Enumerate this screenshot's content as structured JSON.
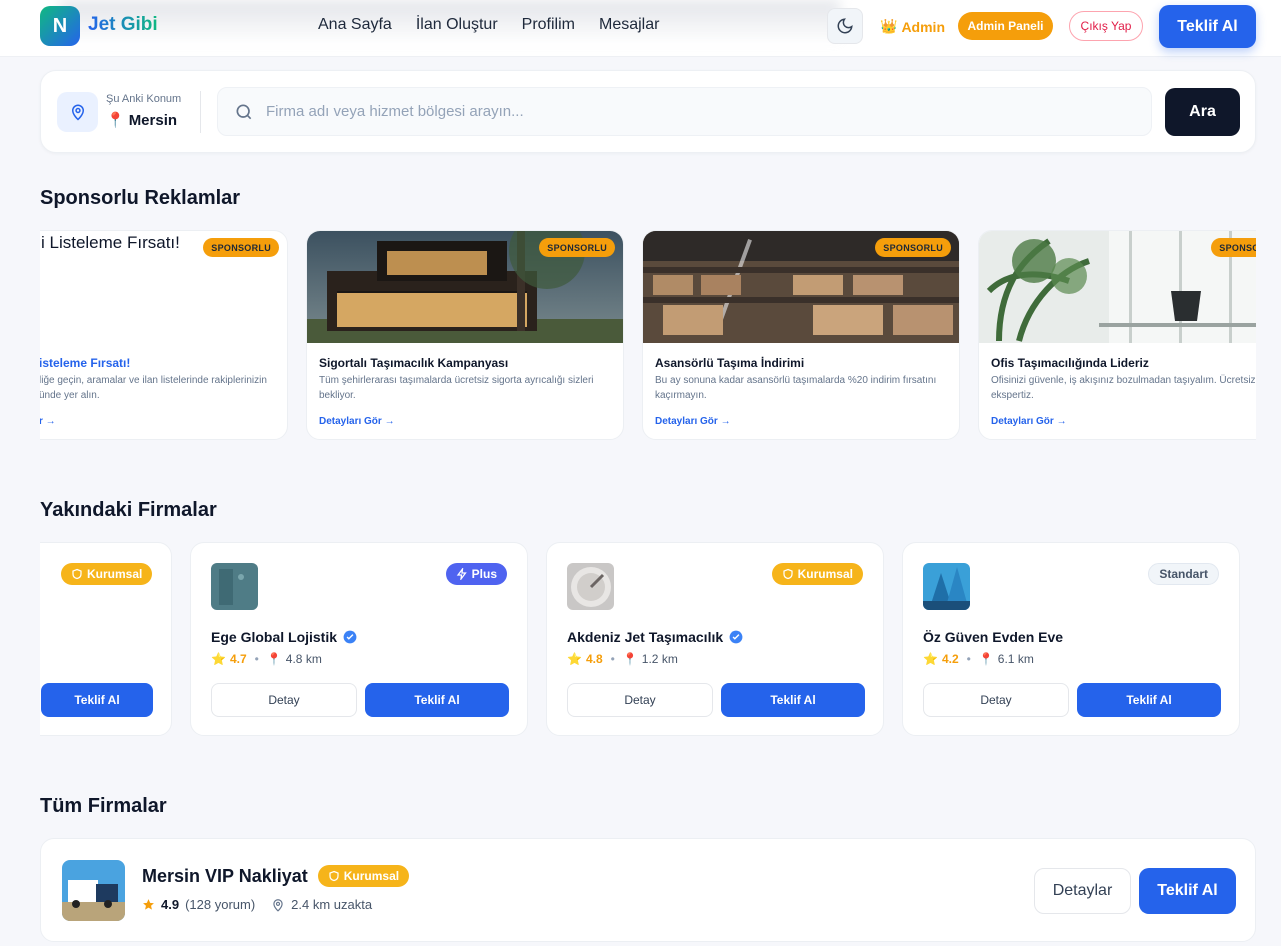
{
  "brand": {
    "logo_letter": "N",
    "name": "Jet Gibi"
  },
  "nav": {
    "links": [
      "Ana Sayfa",
      "İlan Oluştur",
      "Profilim",
      "Mesajlar"
    ],
    "admin_label": "Admin",
    "admin_panel": "Admin Paneli",
    "logout": "Çıkış Yap",
    "quote": "Teklif Al"
  },
  "search": {
    "location_label": "Şu Anki Konum",
    "location_value": "Mersin",
    "placeholder": "Firma adı veya hizmet bölgesi arayın...",
    "button": "Ara"
  },
  "sponsored": {
    "title": "Sponsorlu Reklamlar",
    "badge": "SPONSORLU",
    "link": "Detayları Gör →",
    "ads": [
      {
        "banner": "i Listeleme Fırsatı!",
        "title": "isteleme Fırsatı!",
        "desc": "liğe geçin, aramalar ve ilan listelerinde rakiplerinizin ünde yer alın.",
        "link": "r →"
      },
      {
        "title": "Sigortalı Taşımacılık Kampanyası",
        "desc": "Tüm şehirlerarası taşımalarda ücretsiz sigorta ayrıcalığı sizleri bekliyor."
      },
      {
        "title": "Asansörlü Taşıma İndirimi",
        "desc": "Bu ay sonuna kadar asansörlü taşımalarda %20 indirim fırsatını kaçırmayın."
      },
      {
        "title": "Ofis Taşımacılığında Lideriz",
        "desc": "Ofisinizi güvenle, iş akışınız bozulmadan taşıyalım. Ücretsiz ekspertiz."
      }
    ]
  },
  "nearby": {
    "title": "Yakındaki Firmalar",
    "detail": "Detay",
    "quote": "Teklif Al",
    "firms": [
      {
        "tier": "Kurumsal"
      },
      {
        "name": "Ege Global Lojistik",
        "tier": "Plus",
        "rating": "4.7",
        "distance": "4.8 km"
      },
      {
        "name": "Akdeniz Jet Taşımacılık",
        "tier": "Kurumsal",
        "rating": "4.8",
        "distance": "1.2 km"
      },
      {
        "name": "Öz Güven Evden Eve",
        "tier": "Standart",
        "rating": "4.2",
        "distance": "6.1 km"
      }
    ]
  },
  "all_firms": {
    "title": "Tüm Firmalar",
    "firm": {
      "name": "Mersin VIP Nakliyat",
      "tier": "Kurumsal",
      "rating": "4.9",
      "reviews": "(128 yorum)",
      "distance": "2.4 km uzakta"
    },
    "detail": "Detaylar",
    "quote": "Teklif Al"
  },
  "colors": {
    "primary": "#2563eb",
    "accent": "#f59e0b",
    "dark": "#0f172a"
  }
}
